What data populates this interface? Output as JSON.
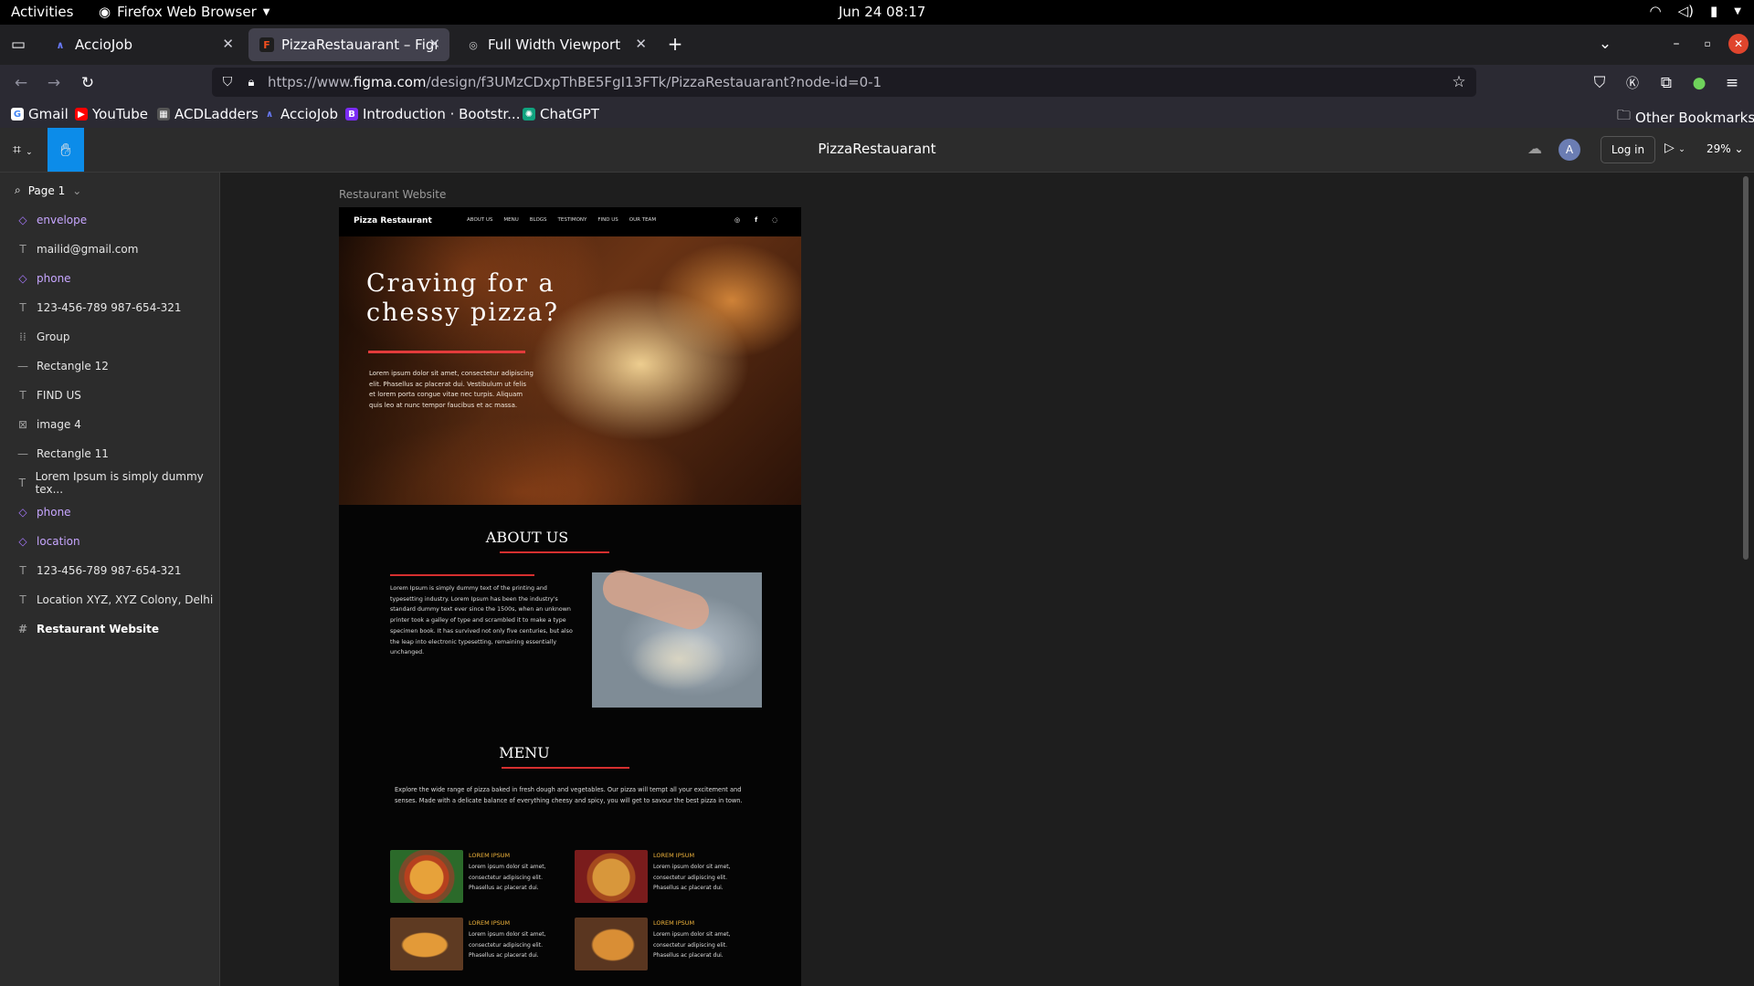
{
  "system": {
    "activities": "Activities",
    "app_name": "Firefox Web Browser",
    "clock": "Jun 24  08:17"
  },
  "browser": {
    "tabs": [
      {
        "title": "AccioJob",
        "active": false
      },
      {
        "title": "PizzaRestauarant – Figma",
        "active": true
      },
      {
        "title": "Full Width Viewport",
        "active": false
      }
    ],
    "url_prefix": "https://www.",
    "url_domain": "figma.com",
    "url_path": "/design/f3UMzCDxpThBE5FgI13FTk/PizzaRestauarant?node-id=0-1",
    "bookmarks": [
      "Gmail",
      "YouTube",
      "ACDLadders",
      "AccioJob",
      "Introduction · Bootstr...",
      "ChatGPT"
    ],
    "other_bookmarks": "Other Bookmarks"
  },
  "figma": {
    "file_title": "PizzaRestauarant",
    "avatar_initial": "A",
    "login_label": "Log in",
    "zoom": "29%",
    "page_name": "Page 1",
    "layers": [
      {
        "name": "envelope",
        "kind": "component"
      },
      {
        "name": "mailid@gmail.com",
        "kind": "text"
      },
      {
        "name": "phone",
        "kind": "component"
      },
      {
        "name": "123-456-789 987-654-321",
        "kind": "text"
      },
      {
        "name": "Group",
        "kind": "group"
      },
      {
        "name": "Rectangle 12",
        "kind": "rect"
      },
      {
        "name": "FIND US",
        "kind": "text"
      },
      {
        "name": "image 4",
        "kind": "image"
      },
      {
        "name": "Rectangle 11",
        "kind": "rect"
      },
      {
        "name": "Lorem Ipsum is simply dummy tex...",
        "kind": "text"
      },
      {
        "name": "phone",
        "kind": "component"
      },
      {
        "name": "location",
        "kind": "component"
      },
      {
        "name": "123-456-789 987-654-321",
        "kind": "text"
      },
      {
        "name": "Location XYZ, XYZ Colony, Delhi",
        "kind": "text"
      },
      {
        "name": "Restaurant Website",
        "kind": "frame"
      }
    ],
    "frame_label": "Restaurant Website"
  },
  "site": {
    "brand": "Pizza Restaurant",
    "nav": [
      "ABOUT US",
      "MENU",
      "BLOGS",
      "TESTIMONY",
      "FIND US",
      "OUR TEAM"
    ],
    "hero_title": "Craving for a chessy pizza?",
    "hero_text": "Lorem ipsum dolor sit amet, consectetur adipiscing elit. Phasellus ac placerat dui. Vestibulum ut felis et lorem porta congue vitae nec turpis. Aliquam quis leo at nunc tempor faucibus et ac massa.",
    "about_title": "ABOUT US",
    "about_text": "Lorem Ipsum is simply dummy text of the printing and typesetting industry. Lorem Ipsum has been the industry's standard dummy text ever since the 1500s, when an unknown printer took a galley of type and scrambled it to make a type specimen book. It has survived not only five centuries, but also the leap into electronic typesetting, remaining essentially unchanged.",
    "menu_title": "MENU",
    "menu_text": "Explore the wide range of pizza baked in fresh dough and vegetables. Our pizza will tempt all your excitement and senses. Made with a delicate balance of everything cheesy and spicy, you will get to savour the best pizza in town.",
    "menu_items": [
      {
        "title": "LOREM IPSUM",
        "desc": "Lorem ipsum dolor sit amet, consectetur adipiscing elit. Phasellus ac placerat dui."
      },
      {
        "title": "LOREM IPSUM",
        "desc": "Lorem ipsum dolor sit amet, consectetur adipiscing elit. Phasellus ac placerat dui."
      },
      {
        "title": "LOREM IPSUM",
        "desc": "Lorem ipsum dolor sit amet, consectetur adipiscing elit. Phasellus ac placerat dui."
      },
      {
        "title": "LOREM IPSUM",
        "desc": "Lorem ipsum dolor sit amet, consectetur adipiscing elit. Phasellus ac placerat dui."
      }
    ]
  },
  "colors": {
    "accent": "#0c8ce9",
    "red_line": "#d62f2f",
    "menu_gold": "#f0b43c"
  }
}
